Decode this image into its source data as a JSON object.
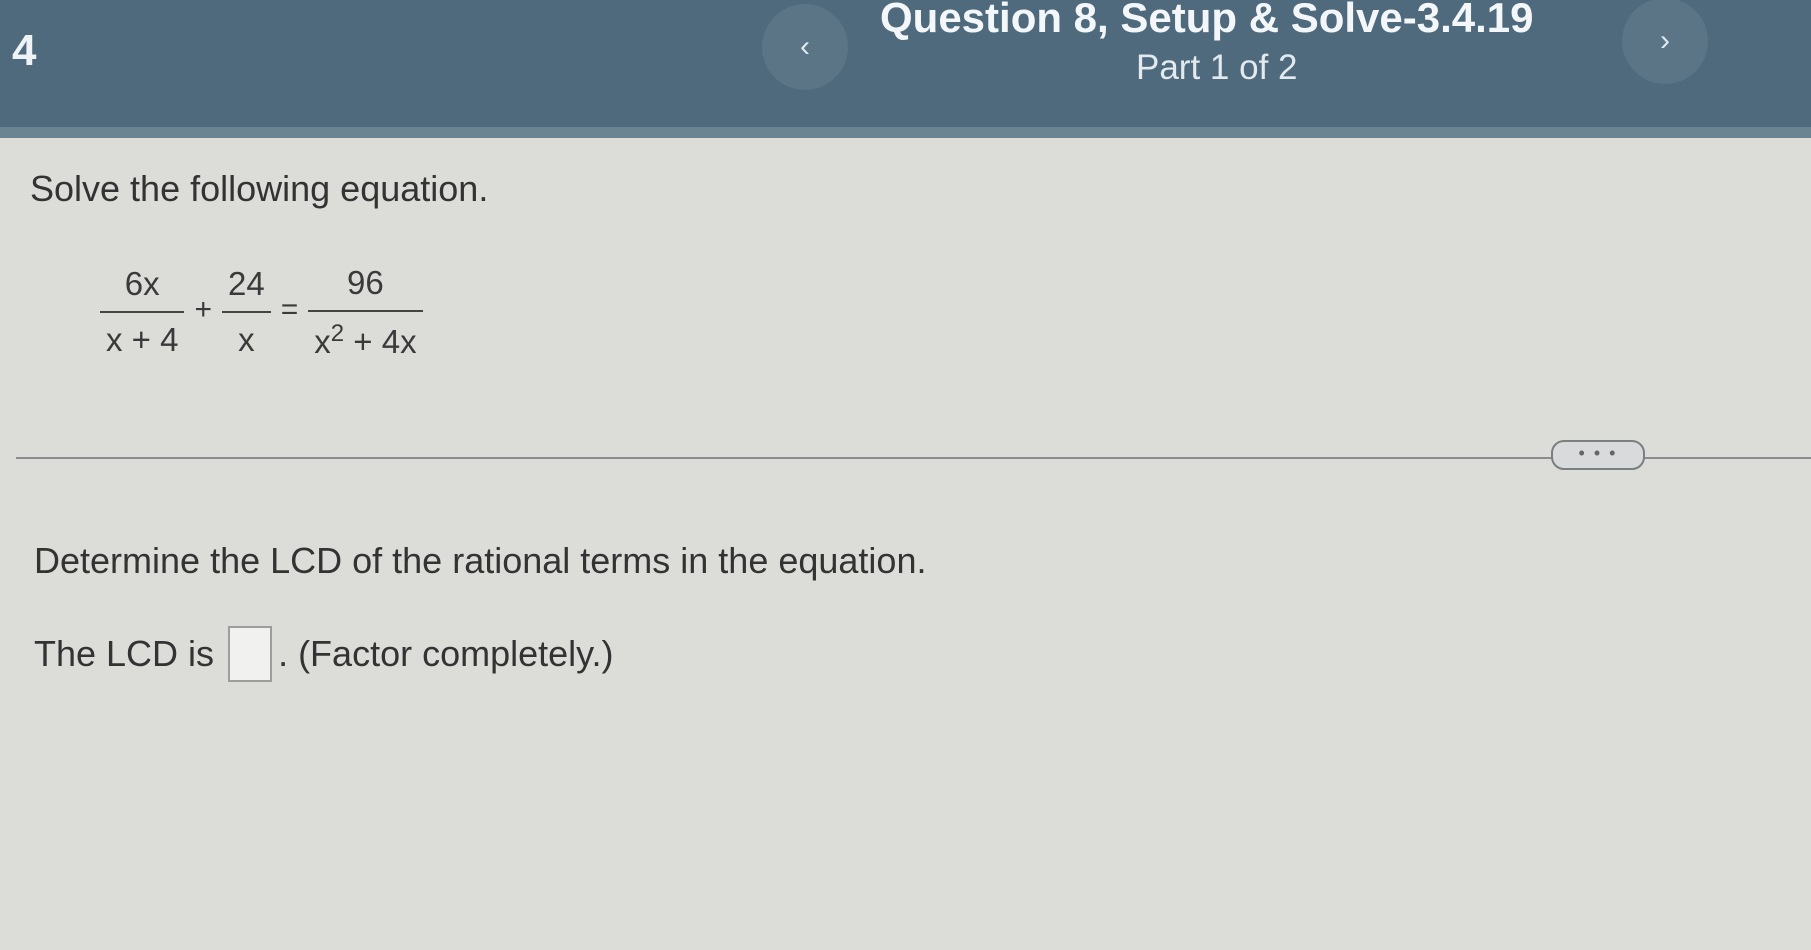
{
  "header": {
    "question_number": "4",
    "prev_icon": "chevron-left-icon",
    "prev_symbol": "‹",
    "title": "Question 8, Setup & Solve-3.4.19",
    "part": "Part 1 of 2",
    "next_icon": "chevron-right-icon",
    "next_symbol": "›"
  },
  "problem": {
    "instruction": "Solve the following equation.",
    "equation": {
      "term1": {
        "numerator": "6x",
        "denominator": "x + 4"
      },
      "op1": "+",
      "term2": {
        "numerator": "24",
        "denominator": "x"
      },
      "op2": "=",
      "term3": {
        "numerator": "96",
        "denominator_base": "x",
        "denominator_exp": "2",
        "denominator_rest": " + 4x"
      }
    }
  },
  "more_button_label": "• • •",
  "step": {
    "prompt": "Determine the LCD of the rational terms in the equation.",
    "answer_prefix": "The LCD is",
    "answer_value": "",
    "answer_suffix": ". (Factor completely.)"
  },
  "colors": {
    "header_bg": "#4f6a7c",
    "content_bg": "#dcdcd9"
  }
}
